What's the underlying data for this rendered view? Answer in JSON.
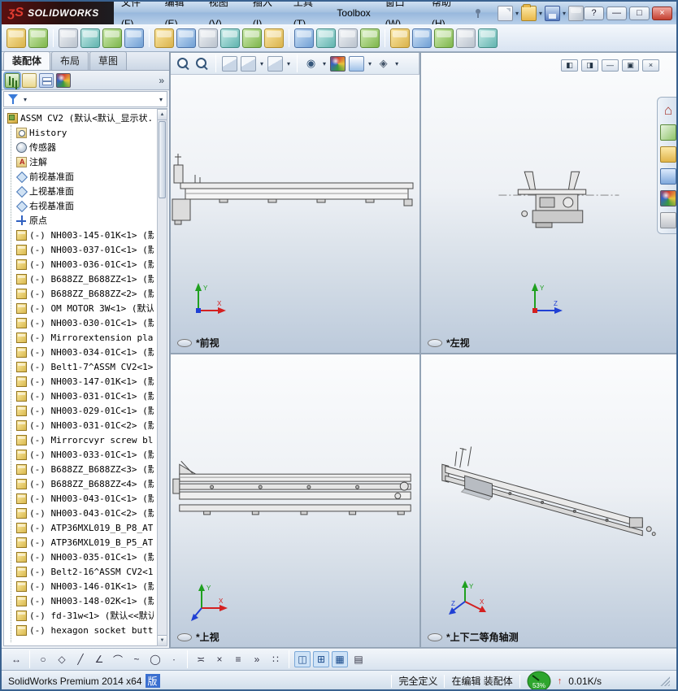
{
  "titlebar": {
    "logo_mark": "ʒS",
    "logo_text": "SOLIDWORKS",
    "menus": [
      {
        "name": "menu-file",
        "label": "文件(F)"
      },
      {
        "name": "menu-edit",
        "label": "编辑(E)"
      },
      {
        "name": "menu-view",
        "label": "视图(V)"
      },
      {
        "name": "menu-insert",
        "label": "插入(I)"
      },
      {
        "name": "menu-tools",
        "label": "工具(T)"
      },
      {
        "name": "menu-toolbox",
        "label": "Toolbox"
      },
      {
        "name": "menu-window",
        "label": "窗口(W)"
      },
      {
        "name": "menu-help",
        "label": "帮助(H)"
      }
    ],
    "quick_access": [
      {
        "name": "new-document",
        "type": "doc",
        "dd": true
      },
      {
        "name": "open-document",
        "type": "folder",
        "dd": true
      },
      {
        "name": "save-document",
        "type": "save",
        "dd": true
      },
      {
        "name": "undo",
        "type": "gray"
      }
    ],
    "window_controls": [
      {
        "name": "help-button",
        "glyph": "?"
      },
      {
        "name": "minimize-window",
        "glyph": "—"
      },
      {
        "name": "maximize-window",
        "glyph": "□"
      },
      {
        "name": "close-window",
        "glyph": "×",
        "type": "close"
      }
    ]
  },
  "toolbar": {
    "icons": [
      {
        "name": "edit-component",
        "type": "amber"
      },
      {
        "name": "insert-components",
        "type": "green"
      },
      {
        "sep": true
      },
      {
        "name": "mate",
        "type": "gray"
      },
      {
        "name": "linear-component-pattern",
        "type": "teal"
      },
      {
        "name": "smart-fasteners",
        "type": "green"
      },
      {
        "name": "move-component",
        "type": "blue"
      },
      {
        "sep": true
      },
      {
        "name": "show-hidden-components",
        "type": "amber"
      },
      {
        "name": "assembly-features",
        "type": "blue"
      },
      {
        "name": "reference-geometry",
        "type": "gray"
      },
      {
        "name": "new-motion-study",
        "type": "teal"
      },
      {
        "name": "bill-of-materials",
        "type": "green"
      },
      {
        "name": "exploded-view",
        "type": "amber"
      },
      {
        "sep": true
      },
      {
        "name": "interference-detection",
        "type": "blue"
      },
      {
        "name": "clearance-verification",
        "type": "teal"
      },
      {
        "name": "hole-alignment",
        "type": "gray"
      },
      {
        "name": "assembly-visualization",
        "type": "green"
      },
      {
        "sep": true
      },
      {
        "name": "measure",
        "type": "amber"
      },
      {
        "name": "mass-properties",
        "type": "blue"
      },
      {
        "name": "section-properties",
        "type": "green"
      },
      {
        "name": "sensor-tool",
        "type": "gray"
      },
      {
        "name": "update-speedpak",
        "type": "teal"
      }
    ]
  },
  "left_panel": {
    "tabs": [
      {
        "name": "tab-assembly",
        "label": "装配体",
        "active": true
      },
      {
        "name": "tab-layout",
        "label": "布局"
      },
      {
        "name": "tab-sketch",
        "label": "草图"
      }
    ],
    "manager_icons": [
      {
        "name": "featuremanager-design-tree",
        "type": "fm",
        "active": true
      },
      {
        "name": "property-manager",
        "type": "pm"
      },
      {
        "name": "configuration-manager",
        "type": "cm"
      },
      {
        "name": "display-manager",
        "type": "ball"
      }
    ],
    "overflow_label": "»",
    "tree": [
      {
        "icon": "assembly",
        "indent": 0,
        "name": "tree-root-assembly",
        "label": "ASSM CV2 (默认<默认_显示状..."
      },
      {
        "icon": "history",
        "indent": 1,
        "name": "tree-item-history",
        "label": "History"
      },
      {
        "icon": "sensor",
        "indent": 1,
        "name": "tree-item-sensors",
        "label": "传感器"
      },
      {
        "icon": "annotation",
        "indent": 1,
        "name": "tree-item-annotations",
        "label": "注解"
      },
      {
        "icon": "plane",
        "indent": 1,
        "name": "tree-item-front-plane",
        "label": "前视基准面"
      },
      {
        "icon": "plane",
        "indent": 1,
        "name": "tree-item-top-plane",
        "label": "上视基准面"
      },
      {
        "icon": "plane",
        "indent": 1,
        "name": "tree-item-right-plane",
        "label": "右视基准面"
      },
      {
        "icon": "origin",
        "indent": 1,
        "name": "tree-item-origin",
        "label": "原点"
      },
      {
        "icon": "part",
        "indent": 1,
        "label": "(-) NH003-145-01K<1> (默"
      },
      {
        "icon": "part",
        "indent": 1,
        "label": "(-) NH003-037-01C<1> (默"
      },
      {
        "icon": "part",
        "indent": 1,
        "label": "(-) NH003-036-01C<1> (默"
      },
      {
        "icon": "part",
        "indent": 1,
        "label": "(-) B688ZZ_B688ZZ<1> (默"
      },
      {
        "icon": "part",
        "indent": 1,
        "label": "(-) B688ZZ_B688ZZ<2> (默"
      },
      {
        "icon": "part",
        "indent": 1,
        "label": "(-) OM MOTOR 3W<1> (默认"
      },
      {
        "icon": "part",
        "indent": 1,
        "label": "(-) NH003-030-01C<1> (默"
      },
      {
        "icon": "part",
        "indent": 1,
        "label": "(-) Mirrorextension pla"
      },
      {
        "icon": "part",
        "indent": 1,
        "label": "(-) NH003-034-01C<1> (默"
      },
      {
        "icon": "part",
        "indent": 1,
        "label": "(-) Belt1-7^ASSM CV2<1> ("
      },
      {
        "icon": "part",
        "indent": 1,
        "label": "(-) NH003-147-01K<1> (默"
      },
      {
        "icon": "part",
        "indent": 1,
        "label": "(-) NH003-031-01C<1> (默"
      },
      {
        "icon": "part",
        "indent": 1,
        "label": "(-) NH003-029-01C<1> (默"
      },
      {
        "icon": "part",
        "indent": 1,
        "label": "(-) NH003-031-01C<2> (默"
      },
      {
        "icon": "part",
        "indent": 1,
        "label": "(-) Mirrorcvyr screw bl"
      },
      {
        "icon": "part",
        "indent": 1,
        "label": "(-) NH003-033-01C<1> (默"
      },
      {
        "icon": "part",
        "indent": 1,
        "label": "(-) B688ZZ_B688ZZ<3> (默"
      },
      {
        "icon": "part",
        "indent": 1,
        "label": "(-) B688ZZ_B688ZZ<4> (默"
      },
      {
        "icon": "part",
        "indent": 1,
        "label": "(-) NH003-043-01C<1> (默"
      },
      {
        "icon": "part",
        "indent": 1,
        "label": "(-) NH003-043-01C<2> (默"
      },
      {
        "icon": "part",
        "indent": 1,
        "label": "(-) ATP36MXL019_B_P8_AT"
      },
      {
        "icon": "part",
        "indent": 1,
        "label": "(-) ATP36MXL019_B_P5_AT"
      },
      {
        "icon": "part",
        "indent": 1,
        "label": "(-) NH003-035-01C<1> (默"
      },
      {
        "icon": "part",
        "indent": 1,
        "label": "(-) Belt2-16^ASSM CV2<1"
      },
      {
        "icon": "part",
        "indent": 1,
        "label": "(-) NH003-146-01K<1> (默"
      },
      {
        "icon": "part",
        "indent": 1,
        "label": "(-) NH003-148-02K<1> (默"
      },
      {
        "icon": "part",
        "indent": 1,
        "label": "(-) fd-31w<1> (默认<<默认"
      },
      {
        "icon": "part",
        "indent": 1,
        "label": "(-) hexagon socket butt"
      }
    ]
  },
  "viewport": {
    "headsup_icons": [
      {
        "name": "zoom-to-fit",
        "type": "mag"
      },
      {
        "name": "zoom-to-area",
        "type": "mag"
      },
      {
        "sep": true
      },
      {
        "name": "section-view",
        "type": "cube"
      },
      {
        "name": "view-orientation",
        "type": "cube",
        "dd": true
      },
      {
        "name": "display-style",
        "type": "cube",
        "dd": true
      },
      {
        "sep": true
      },
      {
        "name": "hide-show-items",
        "type": "eye",
        "glyph": "◉",
        "dd": true
      },
      {
        "name": "edit-appearance",
        "type": "ball"
      },
      {
        "name": "apply-scene",
        "type": "scene",
        "dd": true
      },
      {
        "name": "view-settings",
        "type": "set",
        "glyph": "◈",
        "dd": true
      }
    ],
    "window_buttons": [
      {
        "name": "tile-left-button",
        "glyph": "◧"
      },
      {
        "name": "tile-right-button",
        "glyph": "◨"
      },
      {
        "name": "minimize-document-button",
        "glyph": "—"
      },
      {
        "name": "restore-document-button",
        "glyph": "▣"
      },
      {
        "name": "close-document-button",
        "glyph": "×"
      }
    ],
    "task_pane_icons": [
      {
        "name": "task-pane-home",
        "type": "home",
        "glyph": "⌂"
      },
      {
        "name": "solidworks-resources",
        "type": "res"
      },
      {
        "name": "design-library",
        "type": "lib"
      },
      {
        "name": "file-explorer",
        "type": "exp"
      },
      {
        "name": "appearances-scenes",
        "type": "ball"
      },
      {
        "name": "custom-properties",
        "type": "props"
      }
    ],
    "views": [
      {
        "label": "*前视"
      },
      {
        "label": "*左视"
      },
      {
        "label": "*上视"
      },
      {
        "label": "*上下二等角轴测"
      }
    ],
    "triad_labels": {
      "x": "X",
      "y": "Y",
      "z": "Z"
    }
  },
  "bottom_toolbar": {
    "icons": [
      {
        "name": "smart-dimension",
        "glyph": "↔"
      },
      {
        "sep": true
      },
      {
        "name": "circle-tool",
        "glyph": "○"
      },
      {
        "name": "polygon-tool",
        "glyph": "◇"
      },
      {
        "name": "line-tool",
        "glyph": "╱"
      },
      {
        "name": "centerline-tool",
        "glyph": "∠"
      },
      {
        "name": "arc-tool",
        "glyph": "⌒"
      },
      {
        "name": "spline-tool",
        "glyph": "~"
      },
      {
        "name": "ellipse-tool",
        "glyph": "◯"
      },
      {
        "name": "point-tool",
        "glyph": "∙"
      },
      {
        "sep": true
      },
      {
        "name": "mirror-entities",
        "glyph": "≍"
      },
      {
        "name": "trim-entities",
        "glyph": "×"
      },
      {
        "name": "offset-entities",
        "glyph": "≡"
      },
      {
        "name": "convert-entities",
        "glyph": "»"
      },
      {
        "name": "linear-sketch-pattern",
        "glyph": "∷"
      },
      {
        "sep": true
      },
      {
        "name": "viewport-two-view",
        "glyph": "◫",
        "active": true
      },
      {
        "name": "viewport-four-view",
        "glyph": "⊞",
        "active": true
      },
      {
        "name": "display-grid",
        "glyph": "▦",
        "active": true
      },
      {
        "name": "evaluate-table",
        "glyph": "▤"
      }
    ]
  },
  "statusbar": {
    "product": "SolidWorks Premium 2014 x64",
    "product_suffix": "版",
    "constraint_status": "完全定义",
    "edit_status": "在编辑 装配体",
    "gauge_percent": "53%",
    "net_speed": "0.01K/s"
  },
  "colors": {
    "axis_x": "#d42020",
    "axis_y": "#1fa01f",
    "axis_z": "#2040d4",
    "gauge_green": "#2ea62e",
    "accent": "#3a6fd0"
  }
}
